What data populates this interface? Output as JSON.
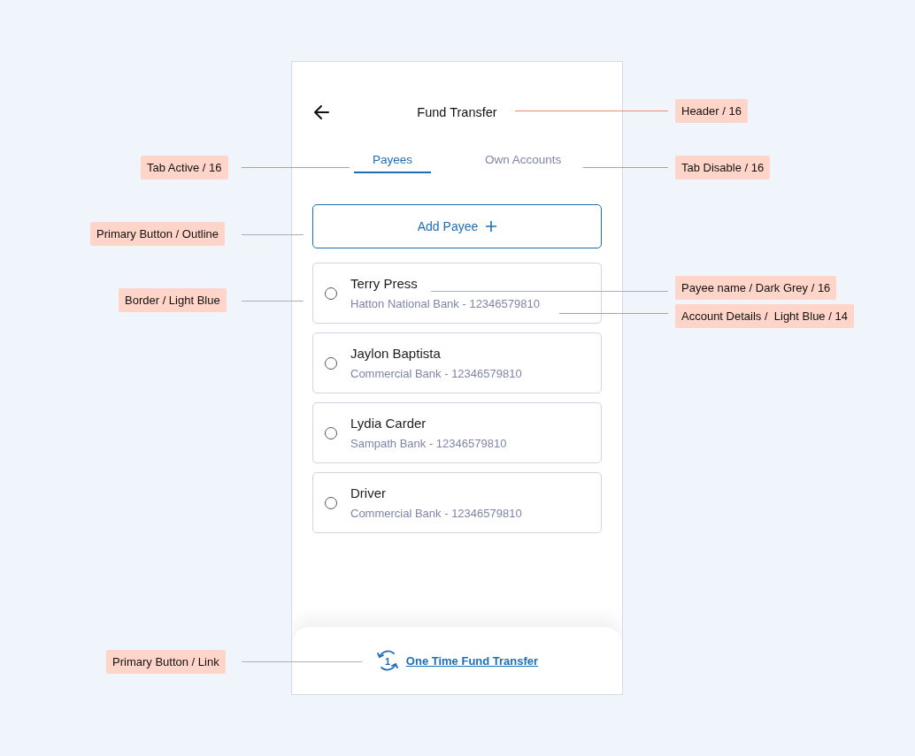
{
  "header": {
    "title": "Fund Transfer"
  },
  "tabs": [
    {
      "label": "Payees",
      "selected": true
    },
    {
      "label": "Own Accounts",
      "selected": false
    }
  ],
  "add_button": {
    "label": "Add Payee"
  },
  "payees": [
    {
      "name": "Terry Press",
      "details": "Hatton National Bank - 12346579810",
      "selected": false
    },
    {
      "name": "Jaylon Baptista",
      "details": "Commercial Bank - 12346579810",
      "selected": false
    },
    {
      "name": "Lydia Carder",
      "details": "Sampath Bank - 12346579810",
      "selected": false
    },
    {
      "name": "Driver",
      "details": "Commercial Bank - 12346579810",
      "selected": false
    }
  ],
  "bottom_link": {
    "label": "One Time Fund Transfer",
    "icon_text": "1"
  },
  "annotations": [
    {
      "text": "Header / 16"
    },
    {
      "text": "Tab Active / 16"
    },
    {
      "text": "Tab Disable / 16"
    },
    {
      "text": "Primary Button / Outline"
    },
    {
      "text": "Border / Light Blue"
    },
    {
      "text": "Payee name / Dark Grey / 16"
    },
    {
      "text": "Account Details /  Light Blue / 14"
    },
    {
      "text": "Primary Button / Link"
    }
  ]
}
